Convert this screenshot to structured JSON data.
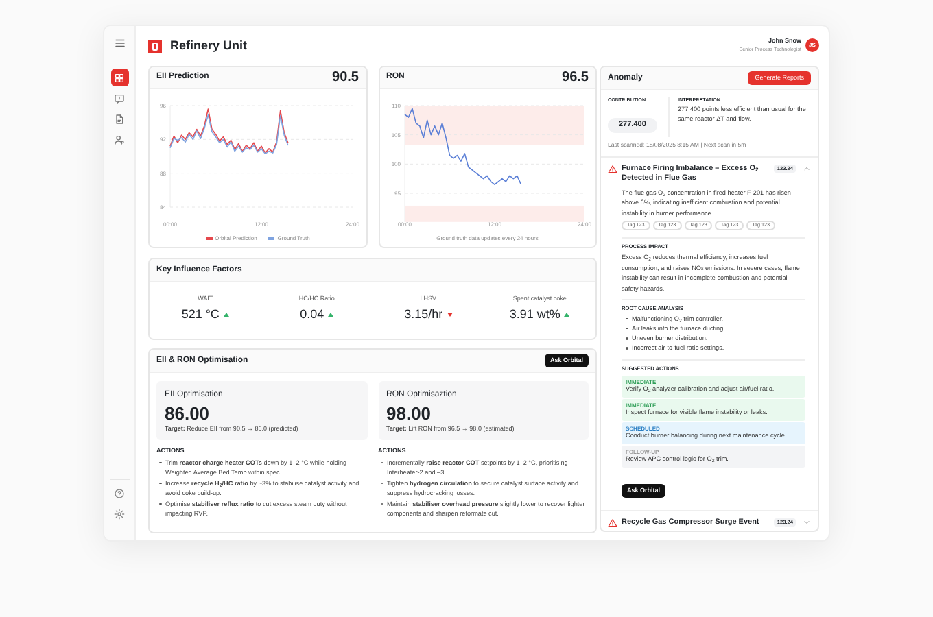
{
  "sidebar": {
    "nav": [
      {
        "kind": "dashboard",
        "selected": true
      },
      {
        "kind": "chat",
        "selected": false
      },
      {
        "kind": "document",
        "selected": false
      },
      {
        "kind": "users",
        "selected": false
      }
    ],
    "bottom": [
      {
        "kind": "help"
      },
      {
        "kind": "settings"
      }
    ]
  },
  "header": {
    "title": "Refinery Unit"
  },
  "user": {
    "name": "John Snow",
    "role": "Senior Process Technologist",
    "initials": "JS"
  },
  "eii_card": {
    "title": "EII Prediction",
    "value": "90.5",
    "chart_data": {
      "type": "line",
      "x": [
        0,
        0.5,
        1,
        1.5,
        2,
        2.5,
        3,
        3.5,
        4,
        4.5,
        5,
        5.5,
        6,
        6.5,
        7,
        7.5,
        8,
        8.5,
        9,
        9.5,
        10,
        10.5,
        11,
        11.5,
        12,
        12.5,
        13,
        13.5,
        14,
        14.5,
        15,
        15.5
      ],
      "xlim": [
        0,
        24
      ],
      "ylim": [
        84,
        96
      ],
      "grid": true,
      "legend": true,
      "xticks": [
        {
          "value": 0,
          "label": "00:00"
        },
        {
          "value": 12,
          "label": "12:00"
        },
        {
          "value": 24,
          "label": "24:00"
        }
      ],
      "yticks": [
        96,
        92,
        88,
        84
      ],
      "series": [
        {
          "name": "Orbital Prediction",
          "color": "#e5484d",
          "values": [
            91.2,
            92.4,
            91.6,
            92.5,
            92.0,
            92.8,
            92.3,
            93.2,
            92.4,
            93.6,
            95.6,
            93.2,
            92.6,
            91.8,
            92.3,
            91.4,
            91.9,
            90.8,
            91.5,
            90.6,
            91.3,
            90.9,
            91.6,
            90.6,
            91.2,
            90.4,
            90.9,
            90.5,
            91.7,
            95.4,
            92.8,
            91.6
          ]
        },
        {
          "name": "Ground Truth",
          "color": "#7fa3e0",
          "values": [
            91.0,
            92.1,
            91.9,
            92.2,
            91.7,
            92.6,
            92.0,
            93.0,
            92.1,
            93.3,
            94.9,
            92.9,
            92.3,
            91.6,
            92.0,
            91.1,
            91.7,
            90.6,
            91.2,
            90.5,
            91.0,
            90.8,
            91.3,
            90.5,
            90.9,
            90.3,
            90.6,
            90.4,
            91.4,
            94.8,
            92.5,
            91.3
          ]
        }
      ]
    }
  },
  "ron_card": {
    "title": "RON",
    "value": "96.5",
    "chart_data": {
      "type": "line",
      "xlabel": "Ground truth data updates every 24 hours",
      "x": [
        0,
        0.5,
        1,
        1.5,
        2,
        2.5,
        3,
        3.5,
        4,
        4.5,
        5,
        5.5,
        6,
        6.5,
        7,
        7.5,
        8,
        8.5,
        9,
        9.5,
        10,
        10.5,
        11,
        11.5,
        12,
        12.5,
        13,
        13.5,
        14,
        14.5,
        15,
        15.5
      ],
      "xlim": [
        0,
        24
      ],
      "ylim": [
        90.1,
        110
      ],
      "grid": true,
      "xticks": [
        {
          "value": 0,
          "label": "00:00"
        },
        {
          "value": 12,
          "label": "12:00"
        },
        {
          "value": 24,
          "label": "24:00"
        }
      ],
      "yticks": [
        110,
        105,
        100,
        95
      ],
      "bands": [
        {
          "axis": "y",
          "from": 103.2,
          "to": 110
        },
        {
          "axis": "y",
          "from": 90.1,
          "to": 92.9
        }
      ],
      "series": [
        {
          "color": "#5b7fd6",
          "values": [
            108.5,
            108.0,
            109.5,
            107.0,
            106.5,
            104.5,
            107.5,
            105.0,
            106.5,
            105.0,
            107.0,
            104.5,
            101.5,
            101.0,
            101.5,
            100.5,
            101.8,
            99.5,
            99.0,
            98.5,
            98.0,
            97.5,
            98.0,
            97.0,
            96.5,
            97.0,
            97.5,
            97.0,
            98.0,
            97.5,
            98.0,
            96.6
          ]
        }
      ]
    }
  },
  "influence": {
    "title": "Key Influence Factors",
    "factors": [
      {
        "label": "WAIT",
        "value": "521 °C",
        "rising": true
      },
      {
        "label": "HC/HC Ratio",
        "value": "0.04",
        "rising": true
      },
      {
        "label": "LHSV",
        "value": "3.15/hr",
        "rising": false
      },
      {
        "label": "Spent catalyst coke",
        "value": "3.91 wt%",
        "rising": true
      }
    ]
  },
  "optimisation": {
    "title": "EII & RON Optimisation",
    "button": "Ask Orbital",
    "columns": [
      {
        "title": "EII Optimisation",
        "value": "86.00",
        "target": "**Target:** Reduce EII from 90.5 → 86.0 (predicted)",
        "actions_heading": "ACTIONS",
        "actions": [
          "Trim **reactor charge heater COTs** down by 1–2 °C while holding Weighted Average Bed Temp within spec.",
          "Increase **recycle H$_{2}$/HC ratio** by ~3% to stabilise catalyst activity and avoid coke build-up.",
          "Optimise **stabiliser reflux ratio** to cut excess steam duty without impacting RVP."
        ]
      },
      {
        "title": "RON Optimisaztion",
        "value": "98.00",
        "target": "**Target:** Lift RON from 96.5 → 98.0 (estimated)",
        "actions_heading": "ACTIONS",
        "actions": [
          "Incrementally **raise reactor COT** setpoints by 1–2 °C, prioritising Interheater-2 and –3.",
          "Tighten **hydrogen circulation** to secure catalyst surface activity and suppress hydrocracking losses.",
          "Maintain **stabiliser overhead pressure** slightly lower to recover lighter components and sharpen reformate cut."
        ]
      }
    ]
  },
  "anomaly": {
    "title": "Anomaly",
    "button": "Generate Reports",
    "contribution_label": "CONTRIBUTION",
    "contribution": "277.400",
    "interpretation_label": "INTERPRETATION",
    "interpretation": "277.400 points less efficient than usual for the same reactor ΔT and flow.",
    "last_scanned": "Last scanned: 18/08/2025 8:15 AM | Next scan in 5m",
    "events": [
      {
        "title": "Furnace Firing Imbalance – Excess O$_{2}$ Detected in Flue Gas",
        "badge": "123.24",
        "expanded": true,
        "description": "The flue gas O$_{2}$ concentration in fired heater F-201 has risen above 6%, indicating inefficient combustion and potential instability in burner performance.",
        "tags": [
          "Tag 123",
          "Tag 123",
          "Tag 123",
          "Tag 123",
          "Tag 123"
        ],
        "impact_heading": "PROCESS IMPACT",
        "impact": "Excess O$_{2}$ reduces thermal efficiency, increases fuel consumption, and raises NO$_{x}$ emissions. In severe cases, flame instability can result in incomplete combustion and potential safety hazards.",
        "causes_heading": "ROOT CAUSE ANALYSIS",
        "causes": [
          "Malfunctioning O$_{2}$ trim controller.",
          "Air leaks into the furnace ducting.",
          "Uneven burner distribution.",
          "Incorrect air-to-fuel ratio settings."
        ],
        "actions_heading": "SUGGESTED ACTIONS",
        "actions": [
          {
            "kind": "immediate",
            "label": "IMMEDIATE",
            "text": "Verify O$_{2}$ analyzer calibration and adjust air/fuel ratio."
          },
          {
            "kind": "immediate",
            "label": "IMMEDIATE",
            "text": "Inspect furnace for visible flame instability or leaks."
          },
          {
            "kind": "scheduled",
            "label": "SCHEDULED",
            "text": "Conduct burner balancing during next maintenance cycle."
          },
          {
            "kind": "followup",
            "label": "FOLLOW-UP",
            "text": "Review APC control logic for O$_{2}$ trim."
          }
        ],
        "button": "Ask Orbital"
      },
      {
        "title": "Recycle Gas Compressor Surge Event",
        "badge": "123.24",
        "expanded": false
      }
    ]
  }
}
